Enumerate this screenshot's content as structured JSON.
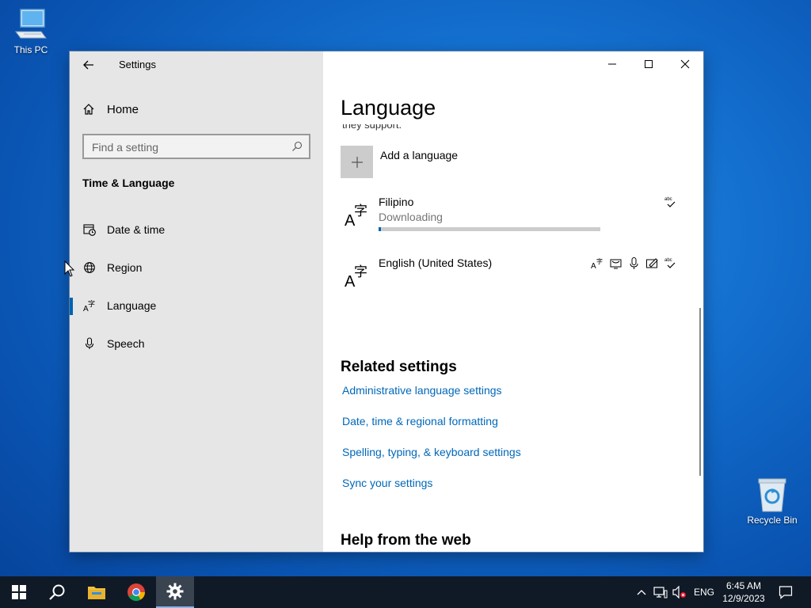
{
  "desktop": {
    "icons": [
      {
        "label": "This PC"
      },
      {
        "label": "Recycle Bin"
      }
    ]
  },
  "window": {
    "app_title": "Settings",
    "sidebar": {
      "home_label": "Home",
      "search_placeholder": "Find a setting",
      "section_title": "Time & Language",
      "items": [
        {
          "label": "Date & time",
          "icon": "calendar-clock-icon"
        },
        {
          "label": "Region",
          "icon": "globe-icon"
        },
        {
          "label": "Language",
          "icon": "language-icon",
          "active": true
        },
        {
          "label": "Speech",
          "icon": "microphone-icon"
        }
      ]
    },
    "main": {
      "title": "Language",
      "clipped_text": "they support.",
      "add_language_label": "Add a language",
      "languages": [
        {
          "name": "Filipino",
          "status": "Downloading",
          "progress": 0.01
        },
        {
          "name": "English (United States)",
          "status": ""
        }
      ],
      "related_title": "Related settings",
      "links": [
        "Administrative language settings",
        "Date, time & regional formatting",
        "Spelling, typing, & keyboard settings",
        "Sync your settings"
      ],
      "help_title": "Help from the web"
    }
  },
  "taskbar": {
    "language": "ENG",
    "time": "6:45 AM",
    "date": "12/9/2023"
  },
  "colors": {
    "accent": "#0063b1",
    "link": "#0067b8",
    "sidebar_bg": "#e6e6e6",
    "taskbar_bg": "#101a26"
  }
}
